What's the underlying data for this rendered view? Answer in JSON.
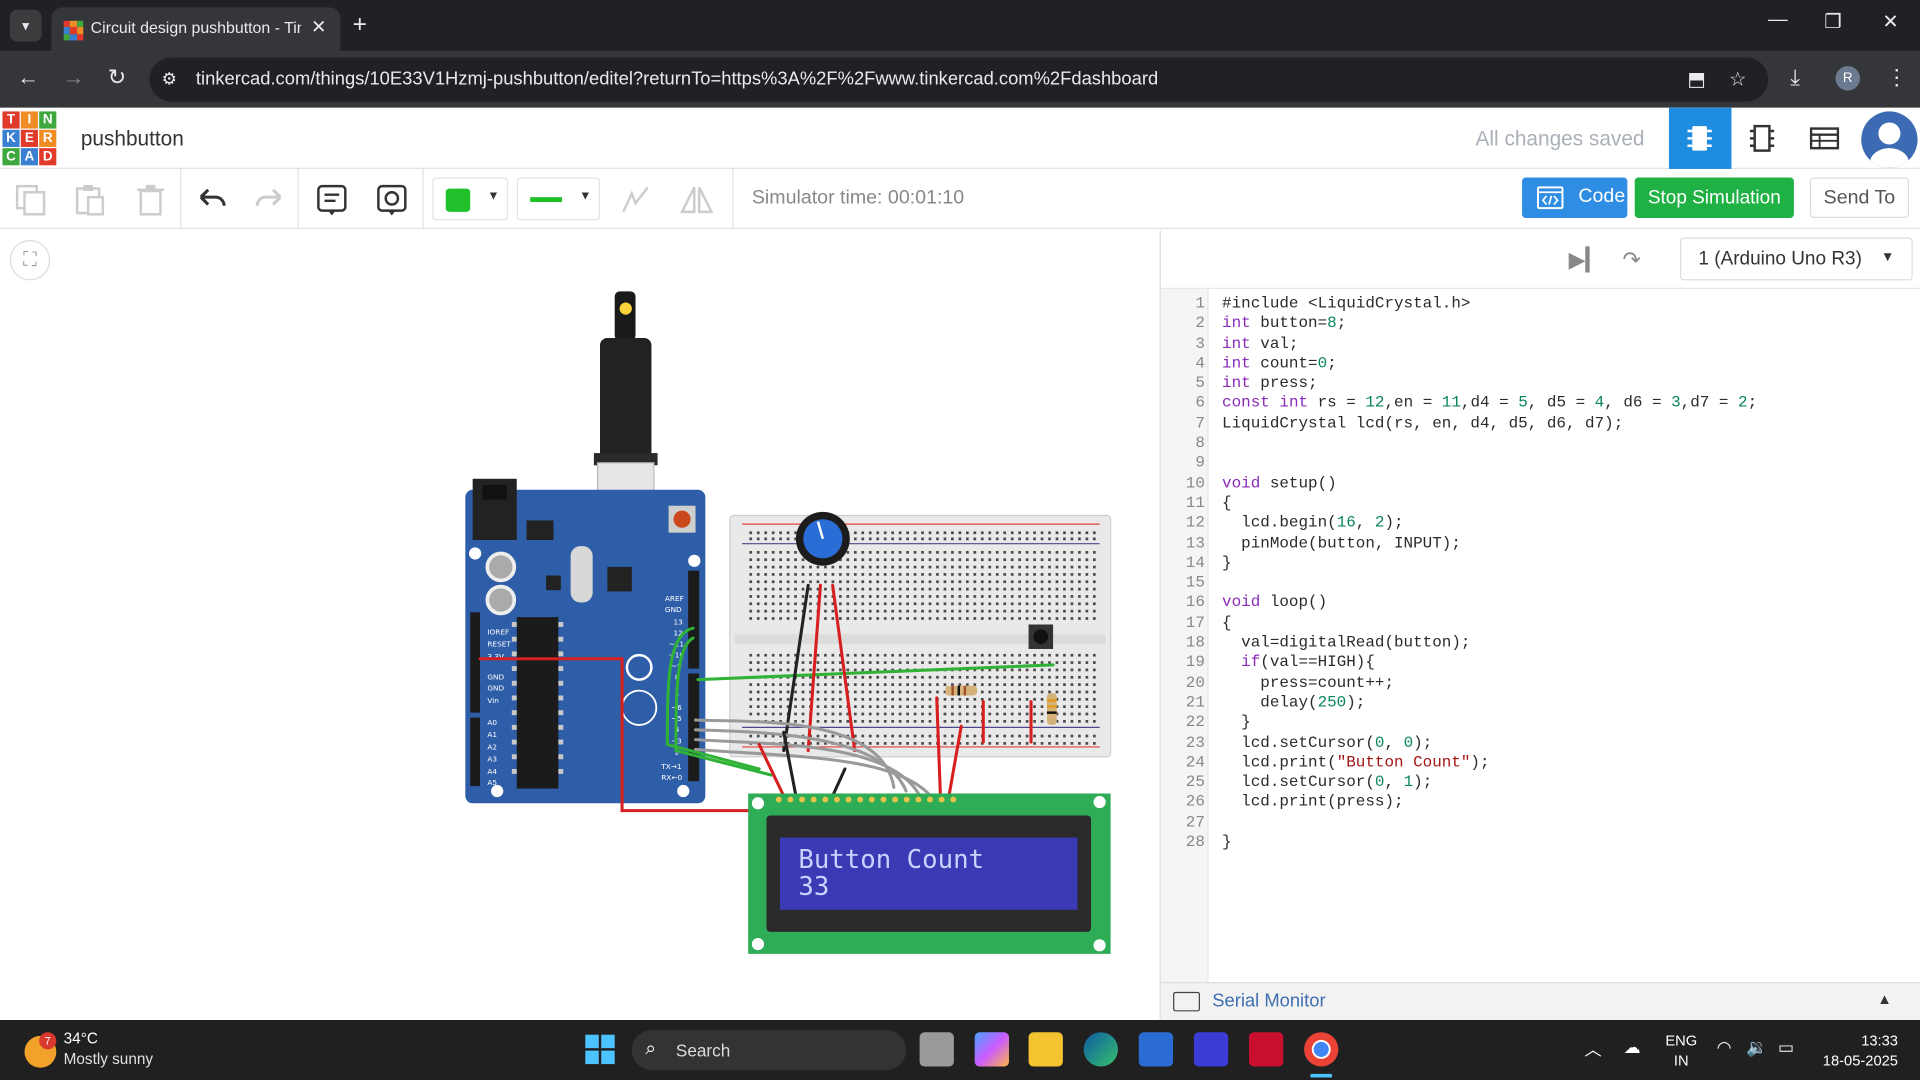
{
  "browser": {
    "tab_title": "Circuit design pushbutton - Tinkercad",
    "url": "tinkercad.com/things/10E33V1Hzmj-pushbutton/editel?returnTo=https%3A%2F%2Fwww.tinkercad.com%2Fdashboard",
    "profile_initial": "R"
  },
  "header": {
    "logo_letters": [
      "T",
      "I",
      "N",
      "K",
      "E",
      "R",
      "C",
      "A",
      "D"
    ],
    "project_name": "pushbutton",
    "save_status": "All changes saved"
  },
  "toolbar": {
    "simulator_time": "Simulator time: 00:01:10",
    "code_label": "Code",
    "stop_label": "Stop Simulation",
    "send_label": "Send To"
  },
  "circuit": {
    "lcd_line1": "Button Count",
    "lcd_line2": "33"
  },
  "code_panel": {
    "device": "1 (Arduino Uno R3)",
    "serial_monitor": "Serial Monitor",
    "lines": [
      "#include <LiquidCrystal.h>",
      "int button=8;",
      "int val;",
      "int count=0;",
      "int press;",
      "const int rs = 12,en = 11,d4 = 5, d5 = 4, d6 = 3,d7 = 2;",
      "LiquidCrystal lcd(rs, en, d4, d5, d6, d7);",
      "",
      "",
      "void setup()",
      "{",
      "  lcd.begin(16, 2);",
      "  pinMode(button, INPUT);",
      "}",
      "",
      "void loop()",
      "{",
      "  val=digitalRead(button);",
      "  if(val==HIGH){",
      "    press=count++;",
      "    delay(250);",
      "  }",
      "  lcd.setCursor(0, 0);",
      "  lcd.print(\"Button Count\");",
      "  lcd.setCursor(0, 1);",
      "  lcd.print(press);",
      "",
      "}"
    ]
  },
  "taskbar": {
    "weather_badge": "7",
    "temperature": "34°C",
    "weather_desc": "Mostly sunny",
    "search_label": "Search",
    "lang_top": "ENG",
    "lang_bottom": "IN",
    "time": "13:33",
    "date": "18-05-2025"
  },
  "colors": {
    "accent_blue": "#1e8de0",
    "stop_green": "#20b145",
    "arduino_blue": "#2e5ea8",
    "lcd_green": "#2eac56"
  }
}
